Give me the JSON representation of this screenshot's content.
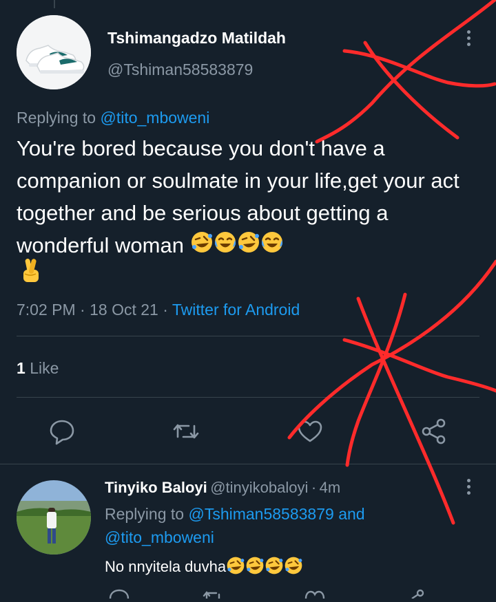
{
  "tweet": {
    "display_name": "Tshimangadzo Matildah",
    "handle": "@Tshiman58583879",
    "replying_prefix": "Replying to",
    "replying_to": "@tito_mboweni",
    "text": "You're bored because you don't have a companion or soulmate in your life,get your act together and be serious about getting a wonderful woman",
    "time": "7:02 PM",
    "sep1": "·",
    "date": "18 Oct 21",
    "sep2": "·",
    "source": "Twitter for Android",
    "like_count": "1",
    "like_label": "Like",
    "emojis": [
      "rofl-emoji",
      "joy-emoji",
      "rofl-emoji",
      "joy-emoji",
      "crossed-fingers-emoji"
    ]
  },
  "actions": [
    "reply-icon",
    "retweet-icon",
    "like-icon",
    "share-icon"
  ],
  "reply": {
    "display_name": "Tinyiko Baloyi",
    "handle": "@tinyikobaloyi",
    "sep": "·",
    "age": "4m",
    "replying_prefix": "Replying to",
    "replying_to_1": "@Tshiman58583879",
    "and": "and",
    "replying_to_2": "@tito_mboweni",
    "text": "No nnyitela duvha",
    "emojis": [
      "rofl-emoji",
      "rofl-emoji",
      "rofl-emoji",
      "rofl-emoji"
    ]
  },
  "colors": {
    "background": "#15202b",
    "secondary_text": "#8b98a5",
    "link": "#1d9bf0",
    "divider": "#38444d",
    "annotation": "#ff2b2b"
  }
}
